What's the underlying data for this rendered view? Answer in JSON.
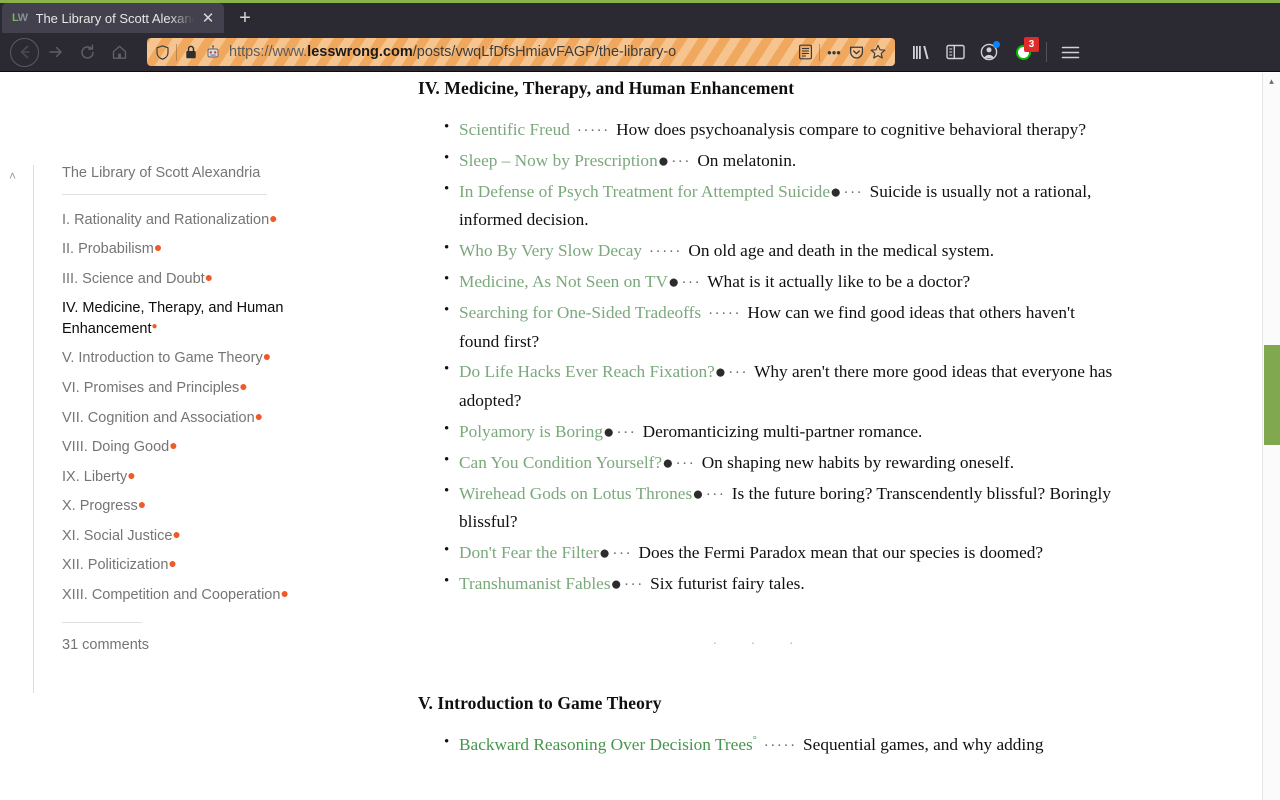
{
  "browser": {
    "tab": {
      "favicon_left": "L",
      "favicon_right": "W",
      "title": "The Library of Scott Alexandria",
      "close_label": "✕"
    },
    "newtab_label": "+",
    "nav": {
      "back": "back-arrow",
      "forward": "forward-arrow",
      "reload": "reload",
      "home": "home"
    },
    "url": {
      "scheme": "https://www.",
      "domain": "lesswrong.com",
      "path": "/posts/vwqLfDfsHmiavFAGP/the-library-o",
      "full": "https://www.lesswrong.com/posts/vwqLfDfsHmiavFAGP/the-library-of-scott-alexandria",
      "shield_icon": "⛨",
      "lock_icon": "🔒",
      "robot_icon": "🤖",
      "reader_icon": "reader-mode",
      "more_icon": "•••",
      "pocket_icon": "pocket",
      "bookmark_icon": "☆"
    },
    "toolbar": {
      "library_label": "library",
      "sidebar_label": "sidebar",
      "account_label": "account",
      "extension_label": "extension",
      "extension_badge": "3",
      "menu_label": "menu"
    }
  },
  "sidebar": {
    "chevron": "˄",
    "title": "The Library of Scott Alexandria",
    "items": [
      {
        "label": "I. Rationality and Rationalization",
        "dot": "●",
        "active": false
      },
      {
        "label": "II. Probabilism",
        "dot": "●",
        "active": false
      },
      {
        "label": "III. Science and Doubt",
        "dot": "●",
        "active": false
      },
      {
        "label": "IV. Medicine, Therapy, and Human Enhancement",
        "dot": "●",
        "active": true
      },
      {
        "label": "V. Introduction to Game Theory",
        "dot": "●",
        "active": false
      },
      {
        "label": "VI. Promises and Principles",
        "dot": "●",
        "active": false
      },
      {
        "label": "VII. Cognition and Association",
        "dot": "●",
        "active": false
      },
      {
        "label": "VIII. Doing Good",
        "dot": "●",
        "active": false
      },
      {
        "label": "IX. Liberty",
        "dot": "●",
        "active": false
      },
      {
        "label": "X. Progress",
        "dot": "●",
        "active": false
      },
      {
        "label": "XI. Social Justice",
        "dot": "●",
        "active": false
      },
      {
        "label": "XII. Politicization",
        "dot": "●",
        "active": false
      },
      {
        "label": "XIII. Competition and Cooperation",
        "dot": "●",
        "active": false
      }
    ],
    "comments": "31 comments"
  },
  "article": {
    "section_4": {
      "heading": "IV. Medicine, Therapy, and Human Enhancement",
      "entries": [
        {
          "link": "Scientific Freud",
          "marker": "",
          "leader": "·····",
          "desc": "How does psychoanalysis compare to cognitive behavioral therapy?"
        },
        {
          "link": "Sleep – Now by Prescription",
          "marker": "●",
          "leader": "···",
          "desc": "On melatonin."
        },
        {
          "link": "In Defense of Psych Treatment for Attempted Suicide",
          "marker": "●",
          "leader": "···",
          "desc": "Suicide is usually not a rational, informed decision."
        },
        {
          "link": "Who By Very Slow Decay",
          "marker": "",
          "leader": "·····",
          "desc": "On old age and death in the medical system."
        },
        {
          "link": "Medicine, As Not Seen on TV",
          "marker": "●",
          "leader": "···",
          "desc": "What is it actually like to be a doctor?"
        },
        {
          "link": "Searching for One-Sided Tradeoffs",
          "marker": "",
          "leader": "·····",
          "desc": "How can we find good ideas that others haven't found first?"
        },
        {
          "link": "Do Life Hacks Ever Reach Fixation?",
          "marker": "●",
          "leader": "···",
          "desc": "Why aren't there more good ideas that everyone has adopted?"
        },
        {
          "link": "Polyamory is Boring",
          "marker": "●",
          "leader": "···",
          "desc": "Deromanticizing multi-partner romance."
        },
        {
          "link": "Can You Condition Yourself?",
          "marker": "●",
          "leader": "···",
          "desc": "On shaping new habits by rewarding oneself."
        },
        {
          "link": "Wirehead Gods on Lotus Thrones",
          "marker": "●",
          "leader": "···",
          "desc": "Is the future boring? Transcendently blissful? Boringly blissful?"
        },
        {
          "link": "Don't Fear the Filter",
          "marker": "●",
          "leader": "···",
          "desc": "Does the Fermi Paradox mean that our species is doomed?"
        },
        {
          "link": "Transhumanist Fables",
          "marker": "●",
          "leader": "···",
          "desc": "Six futurist fairy tales."
        }
      ]
    },
    "divider": "· · ·",
    "section_5": {
      "heading": "V. Introduction to Game Theory",
      "entries": [
        {
          "link": "Backward Reasoning Over Decision Trees",
          "sup": "°",
          "marker": "",
          "leader": "·····",
          "desc": "Sequential games, and why adding",
          "bright": true
        }
      ]
    }
  },
  "scrollbar": {
    "up_arrow": "▴"
  }
}
